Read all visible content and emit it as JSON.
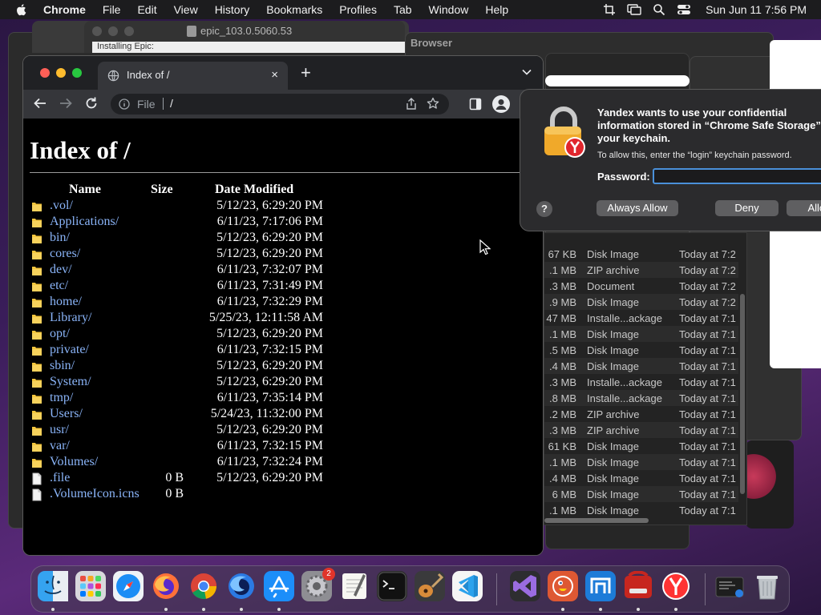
{
  "menubar": {
    "app_name": "Chrome",
    "items": [
      "File",
      "Edit",
      "View",
      "History",
      "Bookmarks",
      "Profiles",
      "Tab",
      "Window",
      "Help"
    ],
    "clock": "Sun Jun 11  7:56 PM"
  },
  "background": {
    "installer_title": "epic_103.0.5060.53",
    "installer_strip": "Installing Epic:",
    "browser_title": "Browser"
  },
  "chrome": {
    "tab_title": "Index of /",
    "new_tab": "+",
    "tab_close": "×",
    "omnibox": {
      "scheme": "File",
      "url": "/"
    }
  },
  "page": {
    "heading": "Index of /",
    "columns": {
      "name": "Name",
      "size": "Size",
      "date": "Date Modified"
    },
    "entries": [
      {
        "name": ".vol/",
        "size": "",
        "date": "5/12/23, 6:29:20 PM",
        "type": "folder"
      },
      {
        "name": "Applications/",
        "size": "",
        "date": "6/11/23, 7:17:06 PM",
        "type": "folder"
      },
      {
        "name": "bin/",
        "size": "",
        "date": "5/12/23, 6:29:20 PM",
        "type": "folder"
      },
      {
        "name": "cores/",
        "size": "",
        "date": "5/12/23, 6:29:20 PM",
        "type": "folder"
      },
      {
        "name": "dev/",
        "size": "",
        "date": "6/11/23, 7:32:07 PM",
        "type": "folder"
      },
      {
        "name": "etc/",
        "size": "",
        "date": "6/11/23, 7:31:49 PM",
        "type": "folder"
      },
      {
        "name": "home/",
        "size": "",
        "date": "6/11/23, 7:32:29 PM",
        "type": "folder"
      },
      {
        "name": "Library/",
        "size": "",
        "date": "5/25/23, 12:11:58 AM",
        "type": "folder"
      },
      {
        "name": "opt/",
        "size": "",
        "date": "5/12/23, 6:29:20 PM",
        "type": "folder"
      },
      {
        "name": "private/",
        "size": "",
        "date": "6/11/23, 7:32:15 PM",
        "type": "folder"
      },
      {
        "name": "sbin/",
        "size": "",
        "date": "5/12/23, 6:29:20 PM",
        "type": "folder"
      },
      {
        "name": "System/",
        "size": "",
        "date": "5/12/23, 6:29:20 PM",
        "type": "folder"
      },
      {
        "name": "tmp/",
        "size": "",
        "date": "6/11/23, 7:35:14 PM",
        "type": "folder"
      },
      {
        "name": "Users/",
        "size": "",
        "date": "5/24/23, 11:32:00 PM",
        "type": "folder"
      },
      {
        "name": "usr/",
        "size": "",
        "date": "5/12/23, 6:29:20 PM",
        "type": "folder"
      },
      {
        "name": "var/",
        "size": "",
        "date": "6/11/23, 7:32:15 PM",
        "type": "folder"
      },
      {
        "name": "Volumes/",
        "size": "",
        "date": "6/11/23, 7:32:24 PM",
        "type": "folder"
      },
      {
        "name": ".file",
        "size": "0 B",
        "date": "5/12/23, 6:29:20 PM",
        "type": "file"
      },
      {
        "name": ".VolumeIcon.icns",
        "size": "0 B",
        "date": "",
        "type": "file"
      }
    ]
  },
  "dialog": {
    "title": "Yandex wants to use your confidential information stored in “Chrome Safe Storage” in your keychain.",
    "subtitle": "To allow this, enter the “login” keychain password.",
    "password_label": "Password:",
    "password_value": "",
    "help": "?",
    "always_allow": "Always Allow",
    "deny": "Deny",
    "allow": "Allow"
  },
  "finder_rows": [
    {
      "size": "67 KB",
      "kind": "Disk Image",
      "date": "Today at 7:2"
    },
    {
      "size": ".1 MB",
      "kind": "ZIP archive",
      "date": "Today at 7:2"
    },
    {
      "size": ".3 MB",
      "kind": "Document",
      "date": "Today at 7:2"
    },
    {
      "size": ".9 MB",
      "kind": "Disk Image",
      "date": "Today at 7:2"
    },
    {
      "size": "47 MB",
      "kind": "Installe...ackage",
      "date": "Today at 7:1"
    },
    {
      "size": ".1 MB",
      "kind": "Disk Image",
      "date": "Today at 7:1"
    },
    {
      "size": ".5 MB",
      "kind": "Disk Image",
      "date": "Today at 7:1"
    },
    {
      "size": ".4 MB",
      "kind": "Disk Image",
      "date": "Today at 7:1"
    },
    {
      "size": ".3 MB",
      "kind": "Installe...ackage",
      "date": "Today at 7:1"
    },
    {
      "size": ".8 MB",
      "kind": "Installe...ackage",
      "date": "Today at 7:1"
    },
    {
      "size": ".2 MB",
      "kind": "ZIP archive",
      "date": "Today at 7:1"
    },
    {
      "size": ".3 MB",
      "kind": "ZIP archive",
      "date": "Today at 7:1"
    },
    {
      "size": "61 KB",
      "kind": "Disk Image",
      "date": "Today at 7:1"
    },
    {
      "size": ".1 MB",
      "kind": "Disk Image",
      "date": "Today at 7:1"
    },
    {
      "size": ".4 MB",
      "kind": "Disk Image",
      "date": "Today at 7:1"
    },
    {
      "size": "6 MB",
      "kind": "Disk Image",
      "date": "Today at 7:1"
    },
    {
      "size": ".1 MB",
      "kind": "Disk Image",
      "date": "Today at 7:1"
    }
  ],
  "dock": {
    "apps": [
      "finder",
      "launchpad",
      "safari",
      "firefox",
      "chrome",
      "firefox-dev",
      "app-store",
      "system-settings",
      "textedit",
      "terminal",
      "instruments",
      "vscode",
      "visual-studio",
      "duckduckgo",
      "maxthon",
      "epic-browser",
      "yandex-browser",
      "finder-window",
      "trash"
    ],
    "settings_badge": "2"
  },
  "colors": {
    "link": "#8ab4f8",
    "folder": "#f3c53d",
    "focus_ring": "#4a90d9"
  }
}
